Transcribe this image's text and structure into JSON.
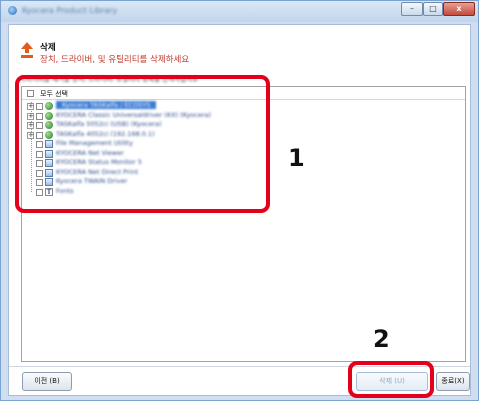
{
  "window": {
    "title": "Kyocera Product Library",
    "minimize": "–",
    "maximize": "□",
    "close": "x"
  },
  "header": {
    "title": "삭제",
    "subtitle": "장치, 드라이버, 및 유틸리티를 삭제하세요"
  },
  "instruction": "드라이버를 제거할 장치, 드라이버, 유틸리티 항목을 선택하십시오",
  "list": {
    "select_all_label": "모두 선택",
    "items": [
      {
        "label": "Kyocera TASKalfa / ECOSYS",
        "icon": "driver-icon",
        "expander": "+",
        "selected": true
      },
      {
        "label": "KYOCERA Classic Universaldriver (KX) (Kyocera)",
        "icon": "driver-icon",
        "expander": "+",
        "selected": false
      },
      {
        "label": "TASKalfa 5052ci (USB) (Kyocera)",
        "icon": "driver-icon",
        "expander": "+",
        "selected": false
      },
      {
        "label": "TASKalfa 4052ci (192.168.0.1)",
        "icon": "driver-icon",
        "expander": "+",
        "selected": false
      },
      {
        "label": "File Management Utility",
        "icon": "app-icon",
        "expander": "",
        "selected": false
      },
      {
        "label": "KYOCERA Net Viewer",
        "icon": "app-icon",
        "expander": "",
        "selected": false
      },
      {
        "label": "KYOCERA Status Monitor 5",
        "icon": "app-icon",
        "expander": "",
        "selected": false
      },
      {
        "label": "KYOCERA Net Direct Print",
        "icon": "app-icon",
        "expander": "",
        "selected": false
      },
      {
        "label": "Kyocera TWAIN Driver",
        "icon": "app-icon",
        "expander": "",
        "selected": false
      },
      {
        "label": "Fonts",
        "icon": "font-icon",
        "expander": "",
        "selected": false
      }
    ]
  },
  "callouts": {
    "list": "1",
    "delete": "2"
  },
  "buttons": {
    "back": "이전 (B)",
    "delete": "삭제 (U)",
    "close": "종료(X)"
  },
  "colors": {
    "accent_red": "#e3001b",
    "subtitle_red": "#c0392b",
    "selection_blue": "#3a7bd5"
  }
}
